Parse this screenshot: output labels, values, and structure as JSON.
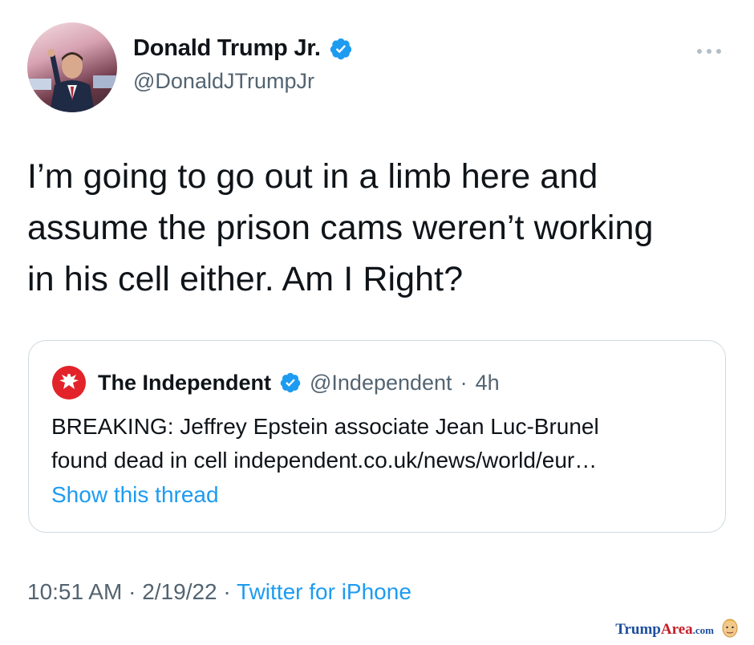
{
  "author": {
    "name": "Donald Trump Jr.",
    "handle": "@DonaldJTrumpJr",
    "verified": true
  },
  "tweet": {
    "lines": [
      "I’m going to go out in a limb here and",
      "assume the prison cams weren’t working",
      "in his cell either. Am I Right?"
    ]
  },
  "quoted": {
    "name": "The Independent",
    "handle": "@Independent",
    "separator": "·",
    "time": "4h",
    "body_lines": [
      "BREAKING: Jeffrey Epstein associate Jean Luc-Brunel",
      "found dead in cell independent.co.uk/news/world/eur…"
    ],
    "thread_link": "Show this thread"
  },
  "meta": {
    "time": "10:51 AM",
    "sep1": "·",
    "date": "2/19/22",
    "sep2": "·",
    "source": "Twitter for iPhone"
  },
  "watermark": {
    "part1": "Trump",
    "part2": "Area",
    "part3": ".com"
  },
  "colors": {
    "link": "#1d9bf0",
    "secondary_text": "#536471",
    "border": "#cfd9de",
    "independent_red": "#e2232a"
  },
  "icons": {
    "verified": "verified-badge-icon",
    "more": "more-options-icon",
    "quoted_avatar": "independent-eagle-logo"
  }
}
